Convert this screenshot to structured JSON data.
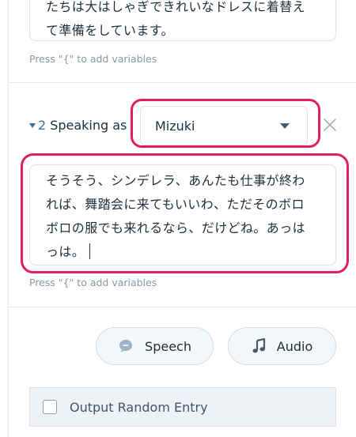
{
  "entry1": {
    "text_line1": "たちは大はしゃぎできれいなドレスに着替え",
    "text_line2": "て準備をしています。",
    "hint": "Press \"{\" to add variables"
  },
  "entry2": {
    "number": "2",
    "speaking_as_label": "Speaking as",
    "speaker": "Mizuki",
    "text_line1": "そうそう、シンデレラ、あんたも仕事が終わ",
    "text_line2": "れば、舞踏会に来てもいいわ、ただそのボロ",
    "text_line3": "ボロの服でも来れるなら、だけどね。あっは",
    "text_line4": "っは。",
    "hint": "Press \"{\" to add variables"
  },
  "buttons": {
    "speech_label": "Speech",
    "speech_icon": "speech-bubble-icon",
    "audio_label": "Audio",
    "audio_icon": "music-note-icon"
  },
  "random": {
    "label": "Output Random Entry",
    "checked": false
  },
  "colors": {
    "highlight": "#e21e62",
    "accent": "#3a6f9c"
  }
}
